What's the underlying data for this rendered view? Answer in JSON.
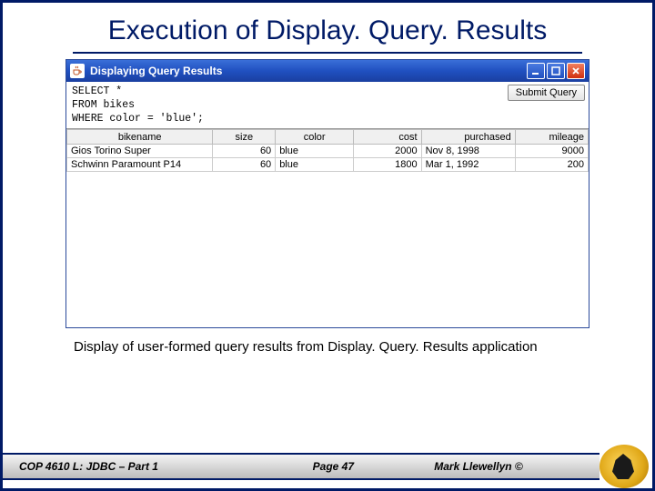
{
  "title": "Execution of Display. Query. Results",
  "window": {
    "title": "Displaying Query Results",
    "query_lines": "SELECT *\nFROM bikes\nWHERE color = 'blue';",
    "submit_label": "Submit Query",
    "columns": [
      "bikename",
      "size",
      "color",
      "cost",
      "purchased",
      "mileage"
    ],
    "rows": [
      {
        "bikename": "Gios Torino Super",
        "size": "60",
        "color": "blue",
        "cost": "2000",
        "purchased": "Nov 8, 1998",
        "mileage": "9000"
      },
      {
        "bikename": "Schwinn Paramount P14",
        "size": "60",
        "color": "blue",
        "cost": "1800",
        "purchased": "Mar 1, 1992",
        "mileage": "200"
      }
    ]
  },
  "caption": "Display of user-formed query results from Display. Query. Results application",
  "footer": {
    "left": "COP 4610 L: JDBC – Part 1",
    "mid": "Page 47",
    "right": "Mark Llewellyn ©"
  }
}
